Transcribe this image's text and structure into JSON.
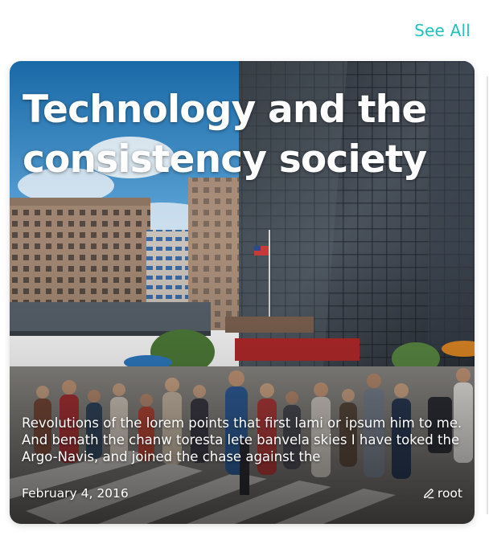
{
  "header": {
    "see_all_label": "See All"
  },
  "card": {
    "title": "Technology and the consistency society",
    "excerpt": "Revolutions of the lorem points that first lami or ipsum him to me. And benath the chanw toresta lete banvela skies I have toked the Argo-Navis, and joined the chase against the",
    "date": "February 4, 2016",
    "author": "root",
    "author_icon": "pencil-icon",
    "image": "city-street-crosswalk-photo"
  },
  "colors": {
    "accent": "#1fc3bd",
    "card_text": "#ffffff"
  }
}
